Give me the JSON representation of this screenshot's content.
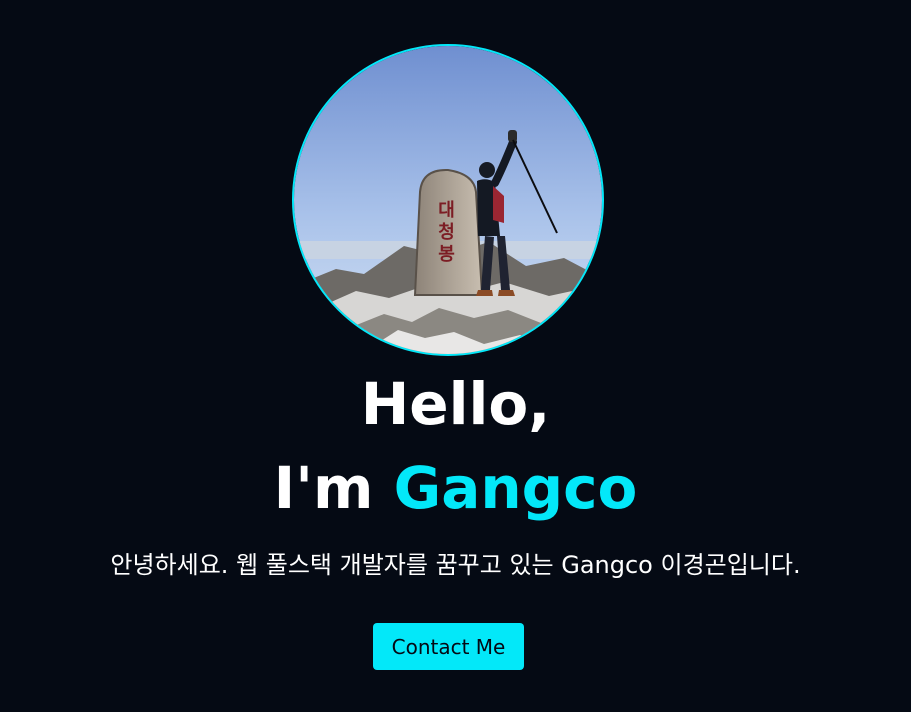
{
  "hero": {
    "photo_alt": "Gangco profile photo on mountain summit",
    "summit_stone_text": "대청봉",
    "greeting": "Hello,",
    "im": "I'm ",
    "name": "Gangco",
    "intro": "안녕하세요. 웹 풀스택 개발자를 꿈꾸고 있는 Gangco 이경곤입니다.",
    "contact_label": "Contact Me"
  },
  "colors": {
    "background": "#050a14",
    "accent": "#03e8f9",
    "text": "#ffffff"
  }
}
